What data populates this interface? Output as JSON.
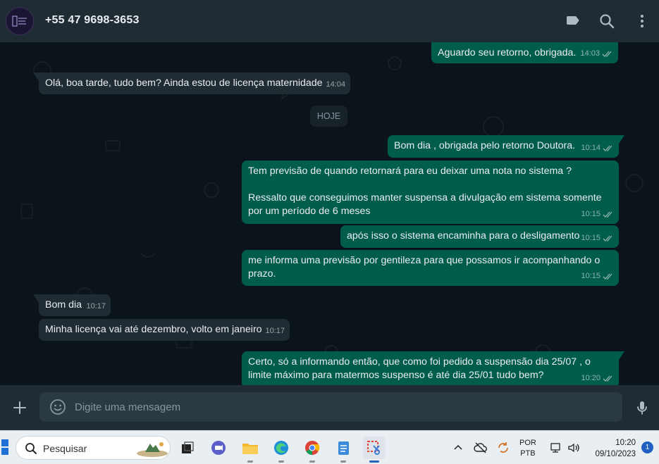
{
  "header": {
    "contact": "+55 47 9698-3653",
    "icons": [
      "label-icon",
      "search-icon",
      "menu-icon"
    ]
  },
  "chat": {
    "date_divider": "HOJE",
    "messages": [
      {
        "dir": "out",
        "text": "Aguardo seu retorno, obrigada.",
        "time": "14:03"
      },
      {
        "dir": "in",
        "text": "Olá, boa tarde, tudo bem? Ainda estou de licença maternidade",
        "time": "14:04"
      },
      {
        "dir": "out",
        "text": "Bom dia , obrigada pelo retorno Doutora.",
        "time": "10:14"
      },
      {
        "dir": "out",
        "text": "Tem previsão de quando retornará para eu deixar uma nota no sistema ?\n\nRessalto que conseguimos manter suspensa a divulgação em sistema somente por um período de 6 meses",
        "time": "10:15"
      },
      {
        "dir": "out",
        "text": "após isso o sistema encaminha para o desligamento",
        "time": "10:15"
      },
      {
        "dir": "out",
        "text": "me informa uma previsão por gentileza para que possamos ir acompanhando o prazo.",
        "time": "10:15"
      },
      {
        "dir": "in",
        "text": "Bom dia",
        "time": "10:17"
      },
      {
        "dir": "in",
        "text": "Minha licença vai até dezembro, volto em janeiro",
        "time": "10:17"
      },
      {
        "dir": "out",
        "text": "Certo, só a informando então, que como foi pedido a suspensão dia 25/07 , o limite máximo para matermos suspenso é até dia 25/01 tudo bem?",
        "time": "10:20"
      }
    ]
  },
  "composer": {
    "placeholder": "Digite uma mensagem"
  },
  "taskbar": {
    "search_label": "Pesquisar",
    "lang_line1": "POR",
    "lang_line2": "PTB",
    "time": "10:20",
    "date": "09/10/2023",
    "notification_count": "1"
  },
  "colors": {
    "outgoing_bubble": "#005c4b",
    "incoming_bubble": "#202c33",
    "header_bg": "#202c33",
    "chat_bg": "#0b141a"
  }
}
